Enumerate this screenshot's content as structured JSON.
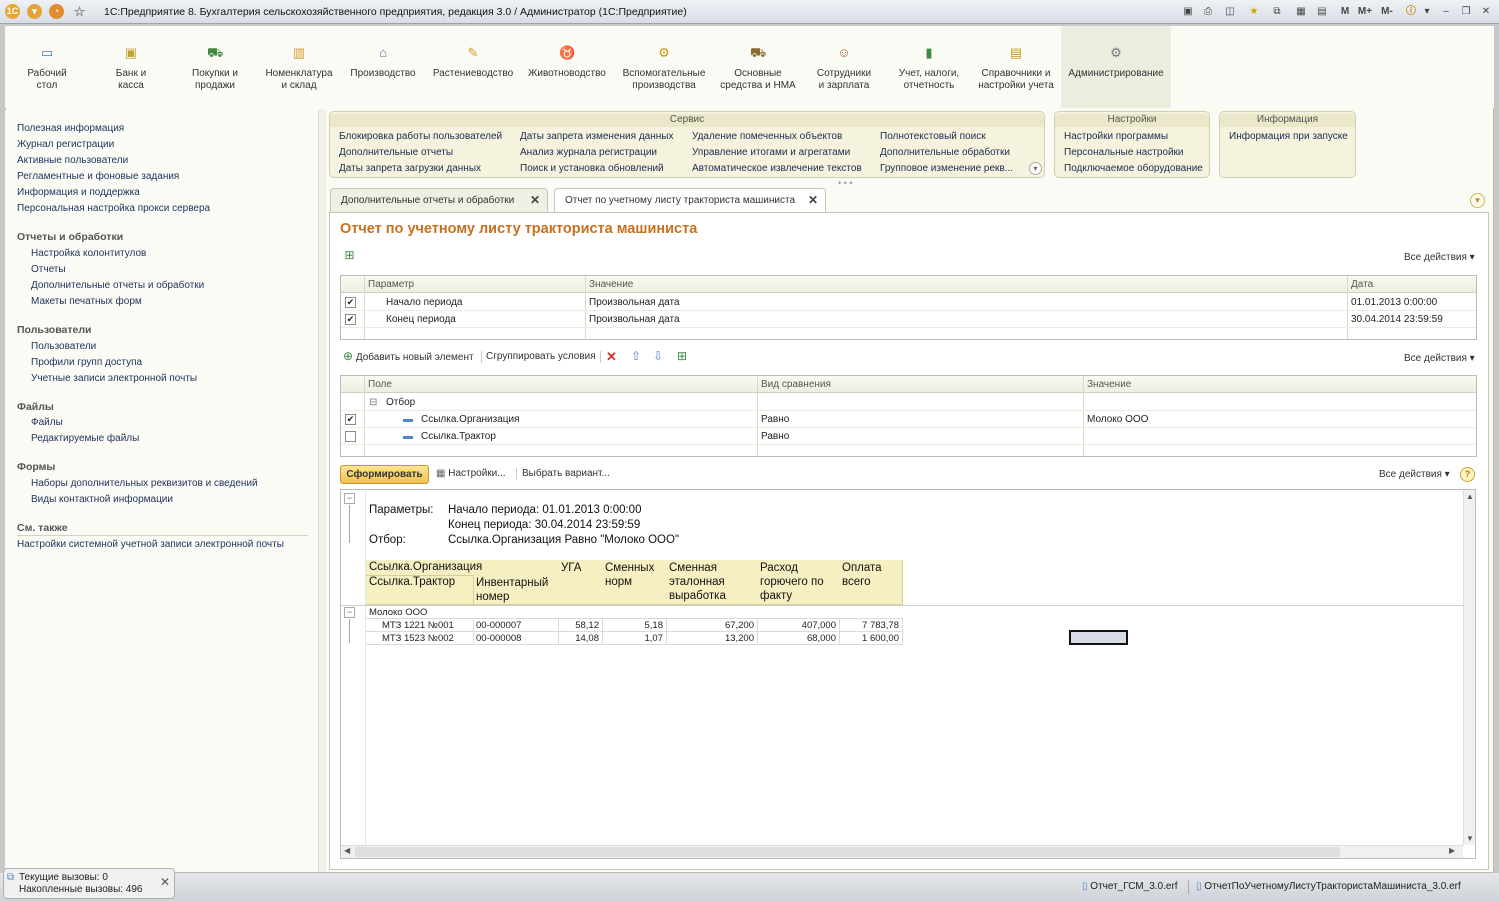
{
  "window": {
    "title": "1С:Предприятие 8. Бухгалтерия сельскохозяйственного предприятия, редакция 3.0 / Администратор  (1С:Предприятие)",
    "right_tools": [
      "M",
      "M+",
      "M-"
    ]
  },
  "sections": [
    {
      "label": "Рабочий\nстол",
      "icon": "desktop-icon"
    },
    {
      "label": "Банк и\nкасса",
      "icon": "bank-icon"
    },
    {
      "label": "Покупки и\nпродажи",
      "icon": "cart-icon"
    },
    {
      "label": "Номенклатура\nи склад",
      "icon": "box-icon"
    },
    {
      "label": "Производство",
      "icon": "factory-icon"
    },
    {
      "label": "Растениеводство",
      "icon": "plant-icon"
    },
    {
      "label": "Животноводство",
      "icon": "cow-icon"
    },
    {
      "label": "Вспомогательные\nпроизводства",
      "icon": "tractor-icon"
    },
    {
      "label": "Основные\nсредства и НМА",
      "icon": "truck-icon"
    },
    {
      "label": "Сотрудники\nи зарплата",
      "icon": "people-icon"
    },
    {
      "label": "Учет, налоги,\nотчетность",
      "icon": "book-icon"
    },
    {
      "label": "Справочники и\nнастройки учета",
      "icon": "folder-icon"
    },
    {
      "label": "Администрирование",
      "icon": "gear-icon"
    }
  ],
  "left_panel": {
    "links": [
      "Полезная информация",
      "Журнал регистрации",
      "Активные пользователи",
      "Регламентные и фоновые задания",
      "Информация и поддержка",
      "Персональная настройка прокси сервера"
    ],
    "groups": [
      {
        "title": "Отчеты и обработки",
        "items": [
          "Настройка колонтитулов",
          "Отчеты",
          "Дополнительные отчеты и обработки",
          "Макеты печатных форм"
        ]
      },
      {
        "title": "Пользователи",
        "items": [
          "Пользователи",
          "Профили групп доступа",
          "Учетные записи электронной почты"
        ]
      },
      {
        "title": "Файлы",
        "items": [
          "Файлы",
          "Редактируемые файлы"
        ]
      },
      {
        "title": "Формы",
        "items": [
          "Наборы дополнительных реквизитов и сведений",
          "Виды контактной информации"
        ]
      }
    ],
    "see_also": {
      "title": "См. также",
      "items": [
        "Настройки системной учетной записи электронной почты"
      ]
    }
  },
  "action_groups": {
    "service": {
      "title": "Сервис",
      "columns": [
        [
          "Блокировка работы пользователей",
          "Дополнительные отчеты",
          "Даты запрета загрузки данных"
        ],
        [
          "Даты запрета изменения данных",
          "Анализ журнала регистрации",
          "Поиск и установка обновлений"
        ],
        [
          "Удаление помеченных объектов",
          "Управление итогами и агрегатами",
          "Автоматическое извлечение текстов"
        ],
        [
          "Полнотекстовый поиск",
          "Дополнительные обработки",
          "Групповое изменение рекв..."
        ]
      ]
    },
    "settings": {
      "title": "Настройки",
      "items": [
        "Настройки программы",
        "Персональные настройки",
        "Подключаемое оборудование"
      ]
    },
    "info": {
      "title": "Информация",
      "items": [
        "Информация при запуске"
      ]
    }
  },
  "tabs": [
    {
      "label": "Дополнительные отчеты и обработки",
      "active": false
    },
    {
      "label": "Отчет по учетному листу тракториста машиниста",
      "active": true
    }
  ],
  "form": {
    "title": "Отчет по учетному листу тракториста машиниста",
    "all_actions": "Все действия",
    "params_grid": {
      "headers": [
        "Параметр",
        "Значение",
        "Дата"
      ],
      "rows": [
        {
          "checked": true,
          "param": "Начало периода",
          "value": "Произвольная дата",
          "date": "01.01.2013 0:00:00"
        },
        {
          "checked": true,
          "param": "Конец периода",
          "value": "Произвольная дата",
          "date": "30.04.2014 23:59:59"
        }
      ]
    },
    "filter_toolbar": {
      "add": "Добавить новый элемент",
      "group": "Сгруппировать условия"
    },
    "filter_grid": {
      "headers": [
        "Поле",
        "Вид сравнения",
        "Значение"
      ],
      "group_label": "Отбор",
      "rows": [
        {
          "checked": true,
          "field": "Ссылка.Организация",
          "compare": "Равно",
          "value": "Молоко ООО"
        },
        {
          "checked": false,
          "field": "Ссылка.Трактор",
          "compare": "Равно",
          "value": ""
        }
      ]
    },
    "report_toolbar": {
      "generate": "Сформировать",
      "settings": "Настройки...",
      "variant": "Выбрать вариант...",
      "help": "?"
    }
  },
  "report": {
    "params_label": "Параметры:",
    "params_lines": [
      "Начало периода: 01.01.2013 0:00:00",
      "Конец периода: 30.04.2014 23:59:59"
    ],
    "filter_label": "Отбор:",
    "filter_value": "Ссылка.Организация Равно \"Молоко ООО\"",
    "header": {
      "org": "Ссылка.Организация",
      "tractor": "Ссылка.Трактор",
      "inv": "Инвентарный\nномер",
      "uga": "УГА",
      "shifts": "Сменных\nнорм",
      "output": "Сменная\nэталонная\nвыработка",
      "fuel": "Расход\nгорючего по\nфакту",
      "pay": "Оплата\nвсего"
    },
    "group": "Молоко ООО",
    "rows": [
      {
        "tractor": "МТЗ 1221 №001",
        "inv": "00-000007",
        "uga": "58,12",
        "shifts": "5,18",
        "output": "67,200",
        "fuel": "407,000",
        "pay": "7 783,78"
      },
      {
        "tractor": "МТЗ 1523 №002",
        "inv": "00-000008",
        "uga": "14,08",
        "shifts": "1,07",
        "output": "13,200",
        "fuel": "68,000",
        "pay": "1 600,00"
      }
    ]
  },
  "status": {
    "current": "Текущие вызовы: 0",
    "total": "Накопленные вызовы: 496"
  },
  "open_files": [
    "Отчет_ГСМ_3.0.erf",
    "ОтчетПоУчетномуЛистуТрактористаМашиниста_3.0.erf"
  ],
  "colors": {
    "accent": "#c8711d",
    "panel": "#fbfbf5",
    "group_bg": "#f5f3de",
    "report_header": "#f6efc2"
  }
}
